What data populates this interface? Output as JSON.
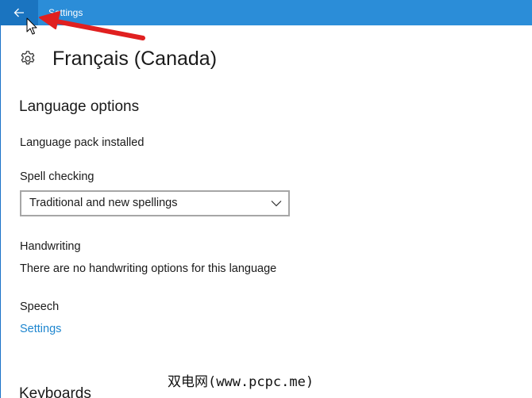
{
  "titlebar": {
    "title": "Settings",
    "back_icon": "back-arrow-icon",
    "accent_color": "#2b8dd8"
  },
  "header": {
    "icon": "gear-icon",
    "title": "Français (Canada)"
  },
  "language_options": {
    "heading": "Language options",
    "pack_status": "Language pack installed",
    "spell_checking": {
      "label": "Spell checking",
      "selected": "Traditional and new spellings"
    },
    "handwriting": {
      "label": "Handwriting",
      "message": "There are no handwriting options for this language"
    },
    "speech": {
      "label": "Speech",
      "link": "Settings",
      "link_color": "#1e86cf"
    }
  },
  "keyboards": {
    "heading": "Keyboards"
  },
  "watermark": "双电网(www.pcpc.me)",
  "annotation": {
    "arrow_color": "#e02020"
  }
}
